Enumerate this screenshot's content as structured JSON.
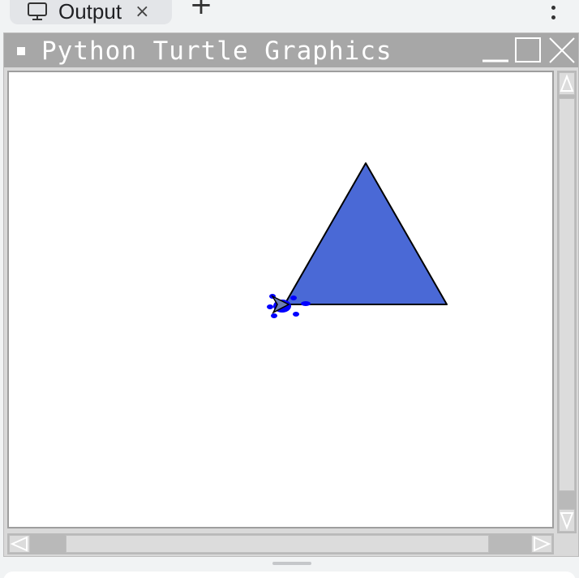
{
  "tabbar": {
    "tab": {
      "label": "Output",
      "icon": "monitor-icon",
      "close_glyph": "×"
    },
    "new_tab_glyph": "+",
    "menu_icon": "kebab-menu-icon"
  },
  "turtle_window": {
    "title": "Python Turtle Graphics",
    "controls": [
      "minimize-icon",
      "maximize-icon",
      "close-icon"
    ],
    "canvas": {
      "background": "#ffffff",
      "triangle": {
        "fill": "#4a69d6",
        "stroke": "#000000"
      },
      "turtle_color": "#0000ff"
    }
  },
  "colors": {
    "titlebar": "#a7a7a7",
    "chrome": "#d9d9d9",
    "scroll_track": "#b9b9b9",
    "page_bg": "#f1f3f4"
  }
}
